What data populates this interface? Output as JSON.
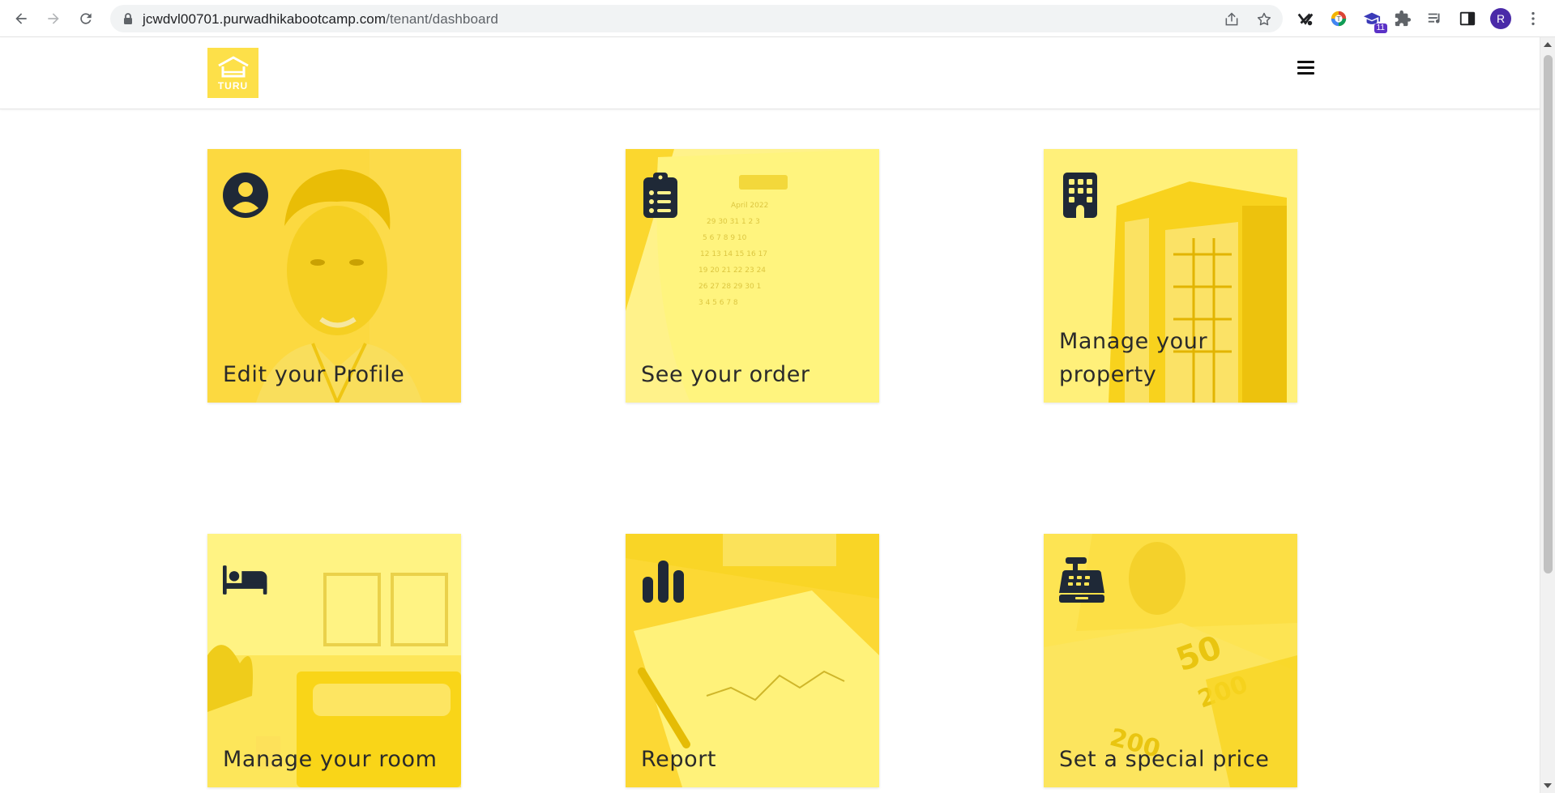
{
  "browser": {
    "url_host": "jcwdvl00701.purwadhikabootcamp.com",
    "url_path": "/tenant/dashboard",
    "extension_badge": "11",
    "profile_initial": "R"
  },
  "site": {
    "logo_text": "TURU",
    "brand_color": "#fde049"
  },
  "cards": [
    {
      "title": "Edit your Profile",
      "icon": "user-circle-icon"
    },
    {
      "title": "See your order",
      "icon": "clipboard-list-icon"
    },
    {
      "title": "Manage your property",
      "icon": "building-icon"
    },
    {
      "title": "Manage your room",
      "icon": "bed-icon"
    },
    {
      "title": "Report",
      "icon": "bar-chart-icon"
    },
    {
      "title": "Set a special price",
      "icon": "cash-register-icon"
    }
  ]
}
